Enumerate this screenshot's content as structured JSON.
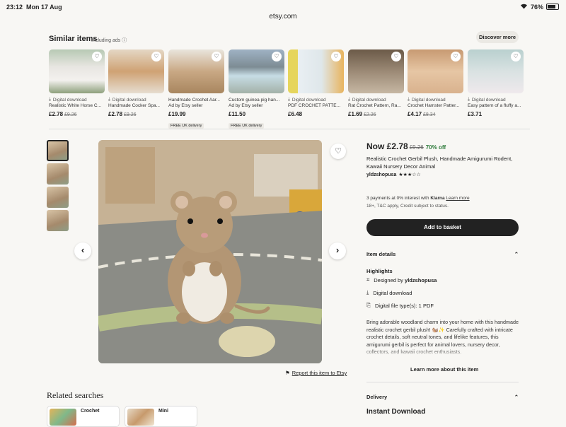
{
  "status": {
    "time": "23:12",
    "date": "Mon 17 Aug",
    "url": "etsy.com",
    "battery": "76%"
  },
  "similar": {
    "title": "Similar items",
    "ads": "Including ads",
    "discover": "Discover more",
    "items": [
      {
        "dl": "Digital download",
        "name": "Realistic White Horse C...",
        "price": "£2.78",
        "old": "£9.26",
        "badge": ""
      },
      {
        "dl": "Digital download",
        "name": "Handmade Cocker Spa...",
        "price": "£2.78",
        "old": "£9.26",
        "badge": ""
      },
      {
        "dl": "Handmade Crochet Aar...",
        "name": "Ad by Etsy seller",
        "price": "£19.99",
        "old": "",
        "badge": "FREE UK delivery"
      },
      {
        "dl": "Custom guinea pig han...",
        "name": "Ad by Etsy seller",
        "price": "£11.50",
        "old": "",
        "badge": "FREE UK delivery"
      },
      {
        "dl": "Digital download",
        "name": "PDF CROCHET PATTE...",
        "price": "£6.48",
        "old": "",
        "badge": ""
      },
      {
        "dl": "Digital download",
        "name": "Rat Crochet Pattern, Ra...",
        "price": "£1.69",
        "old": "£2.26",
        "badge": ""
      },
      {
        "dl": "Digital download",
        "name": "Crochet Hamster Patter...",
        "price": "£4.17",
        "old": "£8.34",
        "badge": ""
      },
      {
        "dl": "Digital download",
        "name": "Easy pattern of a fluffy a...",
        "price": "£3.71",
        "old": "",
        "badge": ""
      }
    ]
  },
  "listing": {
    "now": "Now £2.78",
    "old": "£9.26",
    "off": "70% off",
    "title": "Realistic Crochet Gerbil Plush, Handmade Amigurumi Rodent, Kawaii Nursery Decor Animal",
    "seller": "yldzshopusa",
    "stars": "★★★☆☆",
    "klarna": "3 payments at 0% interest with",
    "klarna_brand": "Klarna",
    "learn_more": "Learn more",
    "klarna_sub": "18+, T&C apply, Credit subject to status.",
    "basket": "Add to basket",
    "item_details": "Item details",
    "highlights": "Highlights",
    "designed_by_prefix": "Designed by",
    "designed_by": "yldzshopusa",
    "digital_download": "Digital download",
    "file_types": "Digital file type(s): 1 PDF",
    "description": "Bring adorable woodland charm into your home with this handmade realistic crochet gerbil plush! 🐿️✨ Carefully crafted with intricate crochet details, soft neutral tones, and lifelike features, this amigurumi gerbil is perfect for animal lovers, nursery decor, collectors, and kawaii crochet enthusiasts.",
    "learn_more_item": "Learn more about this item",
    "delivery": "Delivery",
    "instant": "Instant Download",
    "report": "Report this item to Etsy"
  },
  "related": {
    "title": "Related searches",
    "items": [
      {
        "label": "Crochet"
      },
      {
        "label": "Mini"
      }
    ]
  }
}
